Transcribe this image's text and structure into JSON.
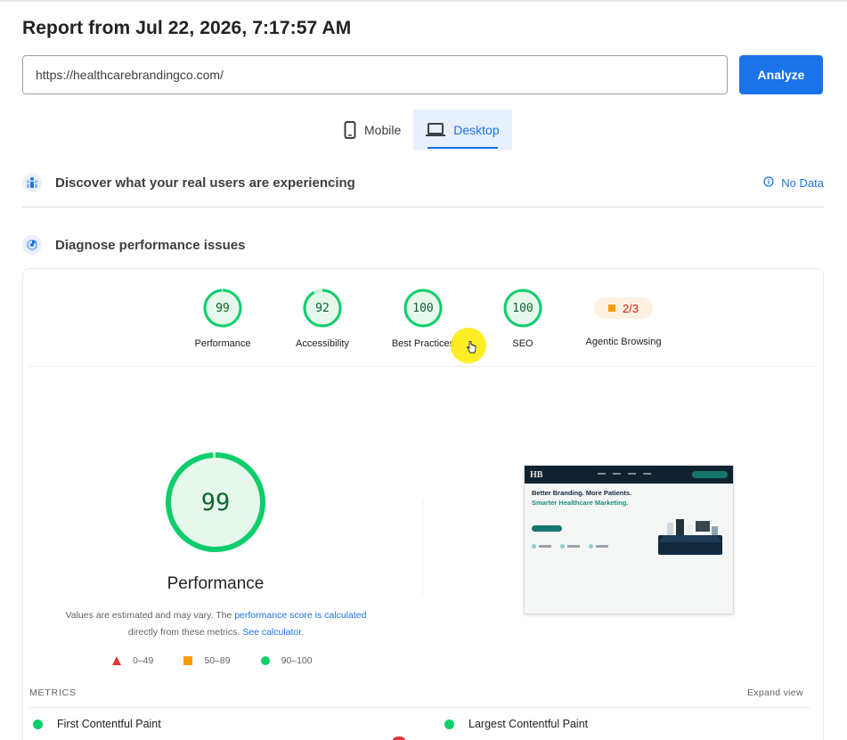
{
  "report": {
    "title": "Report from Jul 22, 2026, 7:17:57 AM"
  },
  "url_form": {
    "value": "https://healthcarebrandingco.com/",
    "analyze_label": "Analyze"
  },
  "device_tabs": [
    {
      "label": "Mobile",
      "icon": "smartphone-icon",
      "active": false
    },
    {
      "label": "Desktop",
      "icon": "laptop-icon",
      "active": true
    }
  ],
  "crux": {
    "heading": "Discover what your real users are experiencing",
    "no_data_label": "No Data",
    "icon": "users-icon"
  },
  "diagnose": {
    "heading": "Diagnose performance issues",
    "icon": "lighthouse-icon"
  },
  "categories": [
    {
      "label": "Performance",
      "score": 99
    },
    {
      "label": "Accessibility",
      "score": 92
    },
    {
      "label": "Best Practices",
      "score": 100
    },
    {
      "label": "SEO",
      "score": 100
    }
  ],
  "agentic": {
    "label": "Agentic Browsing",
    "value": "2/3"
  },
  "performance": {
    "score": "99",
    "title": "Performance",
    "note_before": "Values are estimated and may vary. The ",
    "note_link1": "performance score is calculated",
    "note_middle": " directly from these metrics. ",
    "note_link2": "See calculator",
    "note_after": "."
  },
  "legend": [
    {
      "range": "0–49",
      "shape": "triangle",
      "color": "#e53935"
    },
    {
      "range": "50–89",
      "shape": "square",
      "color": "#fa9c00"
    },
    {
      "range": "90–100",
      "shape": "circle",
      "color": "#0cce6b"
    }
  ],
  "screenshot": {
    "logo": "HB",
    "headline": "Better Branding. More Patients.",
    "subheadline": "Smarter Healthcare Marketing."
  },
  "metrics": {
    "heading": "METRICS",
    "expand_label": "Expand view",
    "items": [
      {
        "name": "First Contentful Paint",
        "status": "good"
      },
      {
        "name": "Largest Contentful Paint",
        "status": "good"
      }
    ]
  },
  "colors": {
    "accent": "#1a73e8",
    "pass": "#0cce6b",
    "pass_text": "#0d652d",
    "pass_fill": "#e6f7ec",
    "average": "#fa9c00",
    "fail": "#e53935"
  }
}
